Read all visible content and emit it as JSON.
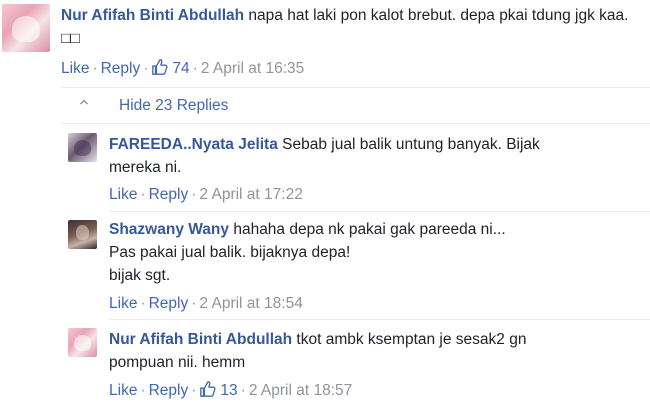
{
  "comments": [
    {
      "author": "Nur Afifah Binti Abdullah",
      "text": "napa hat laki pon kalot brebut. depa pkai tdung jgk kaa. □□",
      "like_label": "Like",
      "reply_label": "Reply",
      "like_count": "74",
      "timestamp": "2 April at 16:35",
      "avatar_icon": "avatar-pink"
    }
  ],
  "hide_replies_label": "Hide 23 Replies",
  "replies": [
    {
      "author": "FAREEDA..Nyata Jelita",
      "text_line1": "Sebab jual balik untung banyak. Bijak",
      "text_line2": "mereka ni.",
      "like_label": "Like",
      "reply_label": "Reply",
      "timestamp": "2 April at 17:22"
    },
    {
      "author": "Shazwany Wany",
      "text_line1": "hahaha depa nk pakai gak pareeda ni...",
      "text_line2": "Pas pakai jual balik. bijaknya depa!",
      "text_line3": "bijak sgt.",
      "like_label": "Like",
      "reply_label": "Reply",
      "timestamp": "2 April at 18:54"
    },
    {
      "author": "Nur Afifah Binti Abdullah",
      "text_line1": "tkot ambk ksemptan je sesak2 gn",
      "text_line2": "pompuan nii. hemm",
      "like_label": "Like",
      "reply_label": "Reply",
      "like_count": "13",
      "timestamp": "2 April at 18:57"
    }
  ],
  "colors": {
    "link": "#4267b2",
    "author": "#365899",
    "meta": "#90949c",
    "text": "#1d2129",
    "divider": "#e9ebee"
  }
}
